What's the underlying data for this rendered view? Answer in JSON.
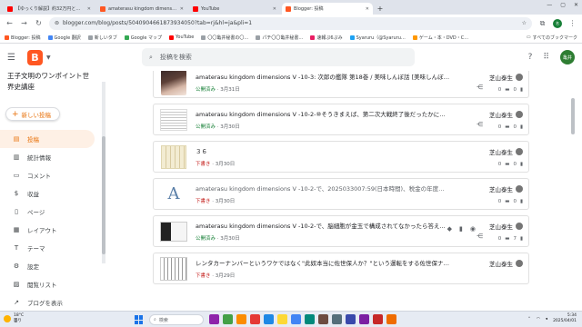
{
  "browser": {
    "tabs": [
      {
        "label": "【ゆっくり解説】約32万円と格安に…",
        "color": "#ff0000",
        "active": false
      },
      {
        "label": "amaterasu kingdom dimensio…",
        "color": "#ff5722",
        "active": false
      },
      {
        "label": "YouTube",
        "color": "#ff0000",
        "active": false
      },
      {
        "label": "Blogger: 投稿",
        "color": "#ff5722",
        "active": true
      }
    ],
    "address": "blogger.com/blog/posts/5040904661873934050?tab=rj&hl=ja&pli=1",
    "profile_initials": "名",
    "bookmarks": [
      {
        "label": "Blogger: 投稿",
        "color": "#ff5722"
      },
      {
        "label": "Google 翻訳",
        "color": "#4285f4"
      },
      {
        "label": "新しいタブ",
        "color": "#9aa0a6"
      },
      {
        "label": "Google マップ",
        "color": "#34a853"
      },
      {
        "label": "YouTube",
        "color": "#ff0000"
      },
      {
        "label": "〇〇亀井秘書の〇…",
        "color": "#9aa0a6"
      },
      {
        "label": "パチ〇〇亀井秘書…",
        "color": "#9aa0a6"
      },
      {
        "label": "速報ぷ6ぷみ",
        "color": "#e91e63"
      },
      {
        "label": "Syaruru（@Syaruru…",
        "color": "#1da1f2"
      },
      {
        "label": "ゲーム・本・DVD・C…",
        "color": "#ff9800"
      }
    ],
    "bookmarks_all": "すべてのブックマーク"
  },
  "header": {
    "logo_letter": "B",
    "search_placeholder": "投稿を検索",
    "avatar_initials": "亀井"
  },
  "sidebar": {
    "blog_title": "王子文明のワンポイント世界史講座",
    "new_post_label": "新しい投稿",
    "items": [
      {
        "label": "投稿",
        "icon": "▤",
        "active": true
      },
      {
        "label": "統計情報",
        "icon": "▥",
        "active": false
      },
      {
        "label": "コメント",
        "icon": "▭",
        "active": false
      },
      {
        "label": "収益",
        "icon": "$",
        "active": false
      },
      {
        "label": "ページ",
        "icon": "▯",
        "active": false
      },
      {
        "label": "レイアウト",
        "icon": "▦",
        "active": false
      },
      {
        "label": "テーマ",
        "icon": "T",
        "active": false
      },
      {
        "label": "設定",
        "icon": "⚙",
        "active": false
      },
      {
        "label": "閲覧リスト",
        "icon": "▨",
        "active": false
      },
      {
        "label": "ブログを表示",
        "icon": "↗",
        "active": false
      }
    ]
  },
  "posts": [
    {
      "title": "amaterasu kingdom dimensions V -10-3: 次郎の艦隊 第18巻 / 美味しんぼ話 [美味しんぼ]をも…",
      "status": "公開済み",
      "date": "3月31日",
      "author": "芝山泰生",
      "comments": "0",
      "views": "0",
      "thumb": "photo"
    },
    {
      "title": "amaterasu kingdom dimensions V -10-2-⑩そうきまえば、第二次大戦終了後だったかに中国東…",
      "status": "公開済み",
      "date": "3月30日",
      "author": "芝山泰生",
      "comments": "0",
      "views": "0",
      "thumb": "doc"
    },
    {
      "title": "３６",
      "status": "下書き",
      "date": "3月30日",
      "author": "芝山泰生",
      "comments": "0",
      "views": "0",
      "thumb": "paper"
    },
    {
      "title": "amaterasu kingdom dimensions V -10-2-で、2025033007:59(日本時間)、税金の年度がどう…",
      "status": "下書き",
      "date": "3月30日",
      "author": "芝山泰生",
      "comments": "0",
      "views": "0",
      "thumb": "A"
    },
    {
      "title": "amaterasu kingdom dimensions V -10-2-で、脳細胞が金玉で構成されてなかったら答えてくれ…",
      "status": "公開済み",
      "date": "3月30日",
      "author": "芝山泰生",
      "comments": "0",
      "views": "7",
      "thumb": "video"
    },
    {
      "title": "レンタカーナンバーというワケではなく\"此奴本当に佐世保人か？\"という運転をする佐世保ナ…",
      "status": "下書き",
      "date": "3月29日",
      "author": "芝山泰生",
      "comments": "",
      "views": "",
      "thumb": "sheet"
    }
  ],
  "taskbar": {
    "weather_temp": "18°C",
    "weather_text": "曇り",
    "search_label": "検索",
    "time": "5:34",
    "date": "2025/04/01"
  }
}
